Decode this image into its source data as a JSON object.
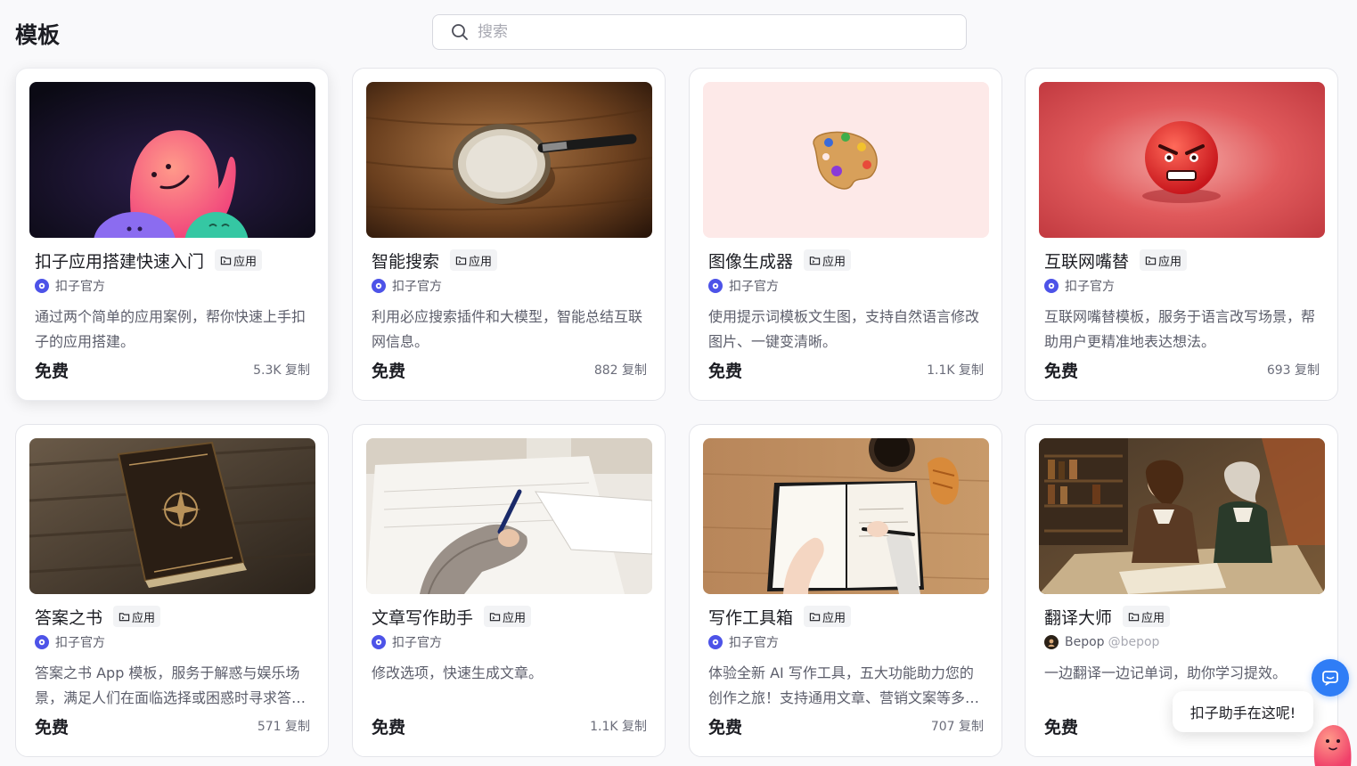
{
  "header": {
    "title": "模板",
    "search_placeholder": "搜索"
  },
  "cards": [
    {
      "title": "扣子应用搭建快速入门",
      "tag": "应用",
      "author": "扣子官方",
      "handle": "",
      "description": "通过两个简单的应用案例，帮你快速上手扣子的应用搭建。",
      "price": "免费",
      "copies": "5.3K 复制",
      "thumb": "mascot-on-dark"
    },
    {
      "title": "智能搜索",
      "tag": "应用",
      "author": "扣子官方",
      "handle": "",
      "description": "利用必应搜索插件和大模型，智能总结互联网信息。",
      "price": "免费",
      "copies": "882 复制",
      "thumb": "magnifier-on-wood"
    },
    {
      "title": "图像生成器",
      "tag": "应用",
      "author": "扣子官方",
      "handle": "",
      "description": "使用提示词模板文生图，支持自然语言修改图片、一键变清晰。",
      "price": "免费",
      "copies": "1.1K 复制",
      "thumb": "palette-on-pink"
    },
    {
      "title": "互联网嘴替",
      "tag": "应用",
      "author": "扣子官方",
      "handle": "",
      "description": "互联网嘴替模板，服务于语言改写场景，帮助用户更精准地表达想法。",
      "price": "免费",
      "copies": "693 复制",
      "thumb": "angry-face-on-red"
    },
    {
      "title": "答案之书",
      "tag": "应用",
      "author": "扣子官方",
      "handle": "",
      "description": "答案之书 App 模板，服务于解惑与娱乐场景，满足人们在面临选择或困惑时寻求答案的需求。",
      "price": "免费",
      "copies": "571 复制",
      "thumb": "ornate-book"
    },
    {
      "title": "文章写作助手",
      "tag": "应用",
      "author": "扣子官方",
      "handle": "",
      "description": "修改选项，快速生成文章。",
      "price": "免费",
      "copies": "1.1K 复制",
      "thumb": "hand-writing"
    },
    {
      "title": "写作工具箱",
      "tag": "应用",
      "author": "扣子官方",
      "handle": "",
      "description": "体验全新 AI 写作工具，五大功能助力您的创作之旅！支持通用文章、营销文案等多种写作场景。",
      "price": "免费",
      "copies": "707 复制",
      "thumb": "notebook-and-croissant"
    },
    {
      "title": "翻译大师",
      "tag": "应用",
      "author": "Bepop",
      "handle": "@bepop",
      "description": "一边翻译一边记单词，助你学习提效。",
      "price": "免费",
      "copies": "",
      "thumb": "scholars-illustration"
    }
  ],
  "assistant": {
    "bubble_text": "扣子助手在这呢!"
  },
  "colors": {
    "accent": "#4d53e8",
    "fab": "#2f7df6",
    "text": "#1c1d23",
    "muted": "#5c5e6b"
  }
}
